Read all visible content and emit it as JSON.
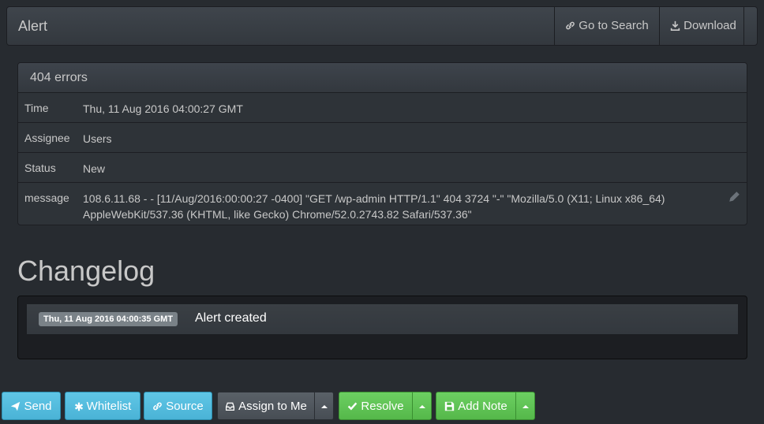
{
  "navbar": {
    "brand": "Alert",
    "go_to_search": "Go to Search",
    "download": "Download"
  },
  "alert": {
    "title": "404 errors",
    "fields": [
      {
        "key": "Time",
        "value": "Thu, 11 Aug 2016 04:00:27 GMT"
      },
      {
        "key": "Assignee",
        "value": "Users"
      },
      {
        "key": "Status",
        "value": "New"
      },
      {
        "key": "message",
        "value_line1": "108.6.11.68 - - [11/Aug/2016:00:00:27 -0400] \"GET /wp-admin HTTP/1.1\" 404 3724 \"-\" \"Mozilla/5.0 (X11; Linux x86_64)",
        "value_line2": "AppleWebKit/537.36 (KHTML, like Gecko) Chrome/52.0.2743.82 Safari/537.36\""
      }
    ]
  },
  "changelog": {
    "heading": "Changelog",
    "entries": [
      {
        "timestamp": "Thu, 11 Aug 2016 04:00:35 GMT",
        "text": "Alert created"
      }
    ]
  },
  "actions": {
    "send": "Send",
    "whitelist": "Whitelist",
    "source": "Source",
    "assign_to_me": "Assign to Me",
    "resolve": "Resolve",
    "add_note": "Add Note"
  },
  "colors": {
    "info": "#5bc0de",
    "success": "#62c462",
    "default": "#52575c",
    "background": "#272b30"
  }
}
